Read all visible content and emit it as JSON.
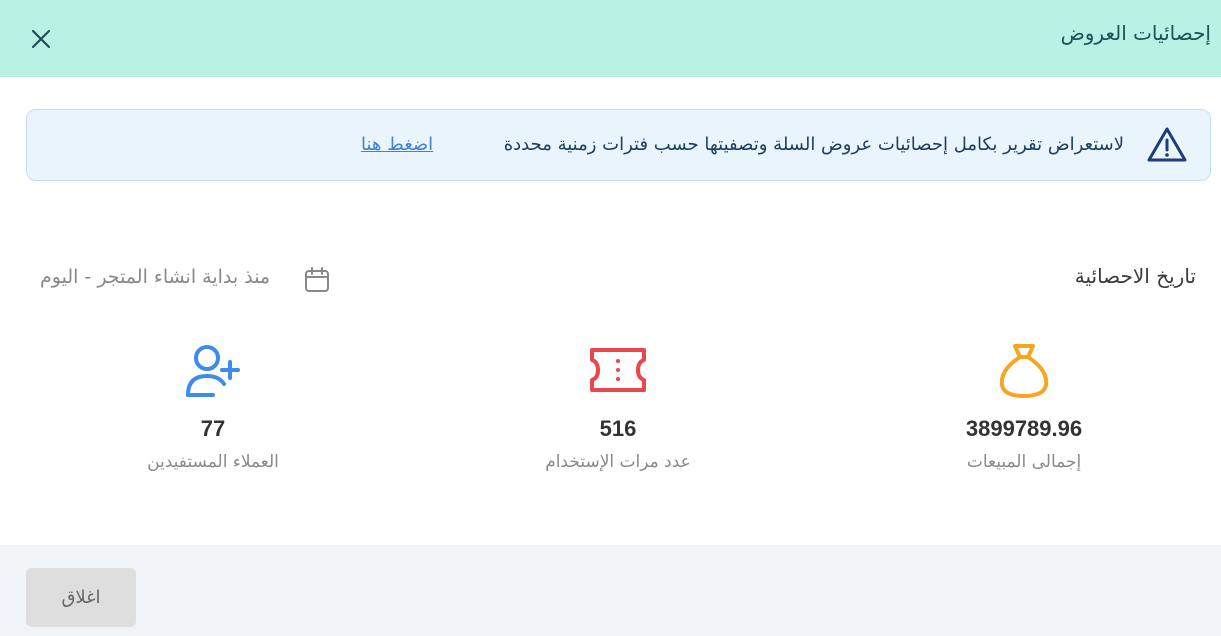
{
  "header": {
    "title": "إحصائيات العروض",
    "close_icon": "close-icon"
  },
  "banner": {
    "icon": "warning-icon",
    "text": "لاستعراض تقرير بكامل إحصائيات عروض السلة وتصفيتها حسب فترات زمنية محددة",
    "link": "اضغط هنا",
    "color": "#eaf4fd"
  },
  "stats": {
    "date_label": "تاريخ الاحصائية",
    "date_value": "منذ بداية انشاء المتجر - اليوم",
    "calendar_icon": "calendar-icon",
    "items": [
      {
        "icon": "money-bag-icon",
        "value": "3899789.96",
        "label": "إجمالى المبيعات",
        "color": "#f5a623"
      },
      {
        "icon": "ticket-icon",
        "value": "516",
        "label": "عدد مرات الإستخدام",
        "color": "#e8474c"
      },
      {
        "icon": "user-plus-icon",
        "value": "77",
        "label": "العملاء المستفيدين",
        "color": "#3d8bea"
      }
    ]
  },
  "footer": {
    "close_label": "اغلاق"
  },
  "colors": {
    "header_bg": "#b9f1e5",
    "footer_bg": "#f0f3f7"
  }
}
